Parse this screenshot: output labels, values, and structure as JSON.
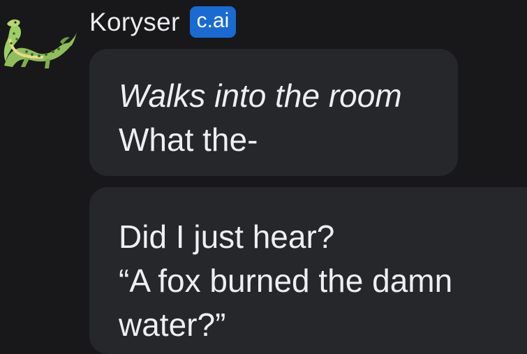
{
  "message": {
    "character_name": "Koryser",
    "badge": "c.ai",
    "avatar_icon": "dragon-avatar-icon",
    "bubbles": [
      {
        "lines": [
          {
            "text": "Walks into the room",
            "italic": true
          },
          {
            "text": "What the-",
            "italic": false
          }
        ]
      },
      {
        "lines": [
          {
            "text": "Did I just hear?",
            "italic": false
          },
          {
            "text": "“A fox burned the damn",
            "italic": false
          },
          {
            "text": "water?”",
            "italic": false
          }
        ]
      }
    ]
  },
  "colors": {
    "background": "#18181b",
    "bubble": "#26272b",
    "badge": "#1a6bd1",
    "text": "#efeff1"
  }
}
